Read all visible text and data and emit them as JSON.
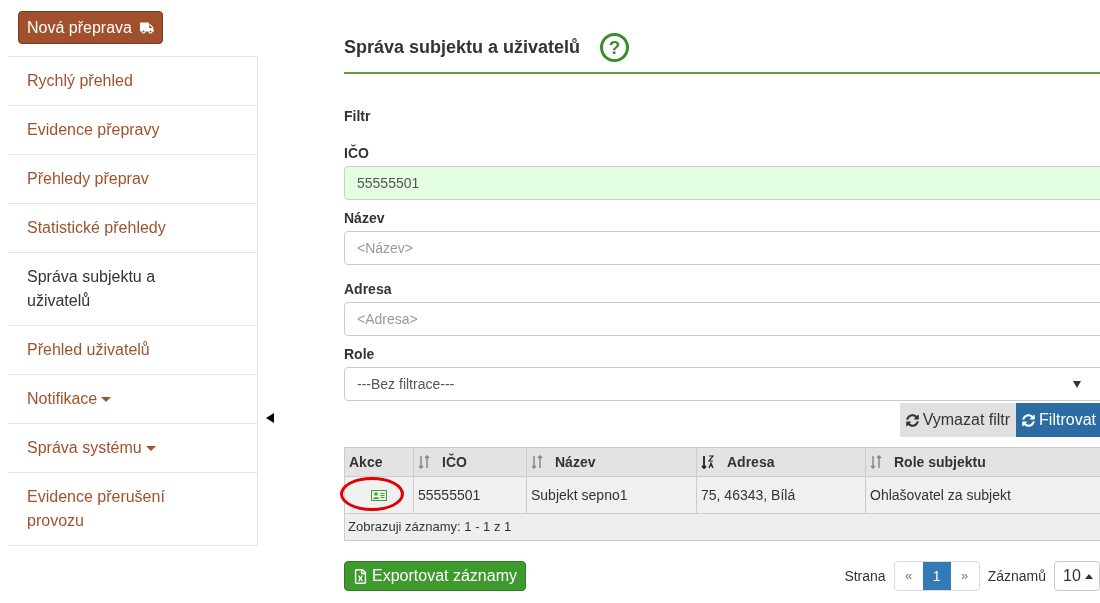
{
  "new_button": {
    "label": "Nová přeprava"
  },
  "sidebar": {
    "items": [
      {
        "label": "Rychlý přehled",
        "selected": false,
        "dropdown": false
      },
      {
        "label": "Evidence přepravy",
        "selected": false,
        "dropdown": false
      },
      {
        "label": "Přehledy přeprav",
        "selected": false,
        "dropdown": false
      },
      {
        "label": "Statistické přehledy",
        "selected": false,
        "dropdown": false
      },
      {
        "label": "Správa subjektu a uživatelů",
        "selected": true,
        "dropdown": false
      },
      {
        "label": "Přehled uživatelů",
        "selected": false,
        "dropdown": false
      },
      {
        "label": "Notifikace",
        "selected": false,
        "dropdown": true
      },
      {
        "label": "Správa systému",
        "selected": false,
        "dropdown": true
      },
      {
        "label": "Evidence přerušení provozu",
        "selected": false,
        "dropdown": false
      }
    ]
  },
  "page": {
    "title": "Správa subjektu a uživatelů",
    "help": "?"
  },
  "filter": {
    "heading": "Filtr",
    "fields": [
      {
        "kind": "text",
        "label": "IČO",
        "value": "55555501",
        "filled": true
      },
      {
        "kind": "text",
        "label": "Název",
        "placeholder": "<Název>",
        "filled": false
      },
      {
        "kind": "text",
        "label": "Adresa",
        "placeholder": "<Adresa>",
        "filled": false
      },
      {
        "kind": "select",
        "label": "Role",
        "value": "---Bez filtrace---",
        "filled": false
      }
    ],
    "buttons": [
      {
        "label": "Vymazat filtr",
        "kind": "secondary"
      },
      {
        "label": "Filtrovat",
        "kind": "primary"
      }
    ]
  },
  "table": {
    "columns": [
      {
        "label": "Akce",
        "sortable": false
      },
      {
        "label": "IČO",
        "sortable": true,
        "sorted": false
      },
      {
        "label": "Název",
        "sortable": true,
        "sorted": false
      },
      {
        "label": "Adresa",
        "sortable": true,
        "sorted": true
      },
      {
        "label": "Role subjektu",
        "sortable": true,
        "sorted": false
      }
    ],
    "rows": [
      {
        "cells": [
          "",
          "55555501",
          "Subjekt sepno1",
          "75, 46343, Bílá",
          "Ohlašovatel za subjekt"
        ]
      }
    ],
    "footer": "Zobrazuji záznamy: 1 - 1 z 1"
  },
  "export_button": {
    "label": "Exportovat záznamy"
  },
  "pagination": {
    "page_label": "Strana",
    "prev": "«",
    "pages": [
      {
        "label": "1",
        "selected": true
      }
    ],
    "next": "»",
    "size_label": "Záznamů",
    "size": "10"
  }
}
